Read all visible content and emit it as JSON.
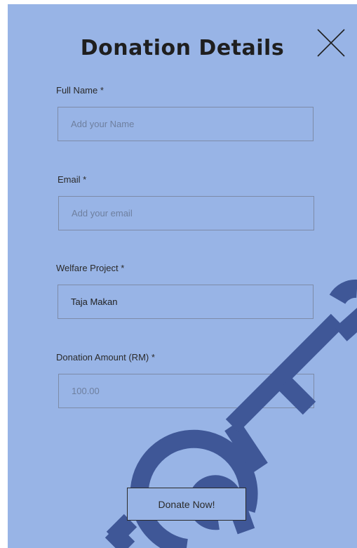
{
  "form": {
    "title": "Donation Details",
    "close_icon": "close-icon",
    "fields": {
      "full_name": {
        "label": "Full Name *",
        "placeholder": "Add your Name",
        "value": ""
      },
      "email": {
        "label": "Email *",
        "placeholder": "Add your email",
        "value": ""
      },
      "welfare_project": {
        "label": "Welfare Project *",
        "value": "Taja Makan"
      },
      "donation_amount": {
        "label": "Donation Amount (RM) *",
        "value": "100.00"
      }
    },
    "submit_label": "Donate Now!"
  },
  "colors": {
    "panel_background": "#98b4e6",
    "watermark": "#3f5797",
    "text": "#1f1f1f"
  }
}
